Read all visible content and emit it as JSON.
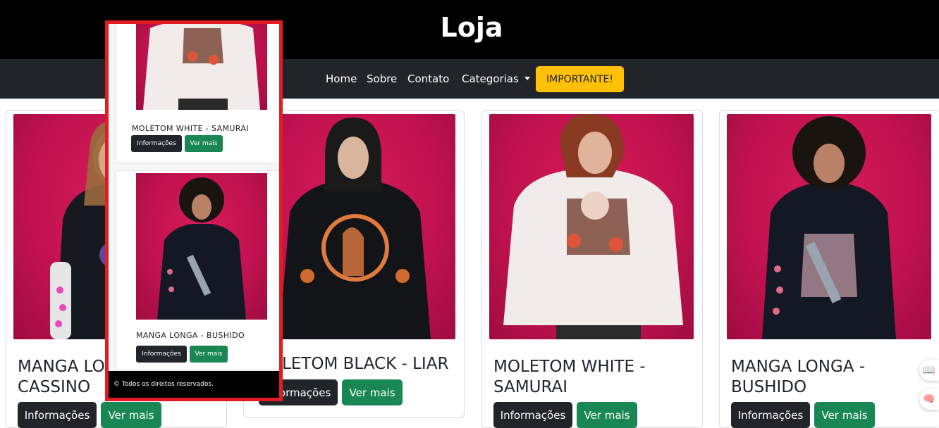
{
  "header": {
    "title": "Loja"
  },
  "nav": {
    "home": "Home",
    "sobre": "Sobre",
    "contato": "Contato",
    "categorias": "Categorias",
    "importante": "IMPORTANTE!"
  },
  "products": [
    {
      "title": "MANGA LONGA - CASSINO",
      "info_label": "Informações",
      "more_label": "Ver mais"
    },
    {
      "title": "MOLETOM BLACK - LIAR",
      "info_label": "Informações",
      "more_label": "Ver mais"
    },
    {
      "title": "MOLETOM WHITE - SAMURAI",
      "info_label": "Informações",
      "more_label": "Ver mais"
    },
    {
      "title": "MANGA LONGA - BUSHIDO",
      "info_label": "Informações",
      "more_label": "Ver mais"
    }
  ],
  "popup": {
    "items": [
      {
        "title": "MOLETOM WHITE - SAMURAI",
        "info_label": "Informações",
        "more_label": "Ver mais"
      },
      {
        "title": "MANGA LONGA - BUSHIDO",
        "info_label": "Informações",
        "more_label": "Ver mais"
      }
    ],
    "footer": "© Todos os direitos reservados."
  },
  "colors": {
    "header_bg": "#000000",
    "navbar_bg": "#212529",
    "important": "#ffc107",
    "btn_dark": "#212529",
    "btn_green": "#198754",
    "photo_bg": "#c2124f",
    "popup_border": "#e31b23"
  },
  "icons": {
    "reader": "book-icon",
    "assistant": "brain-icon"
  }
}
